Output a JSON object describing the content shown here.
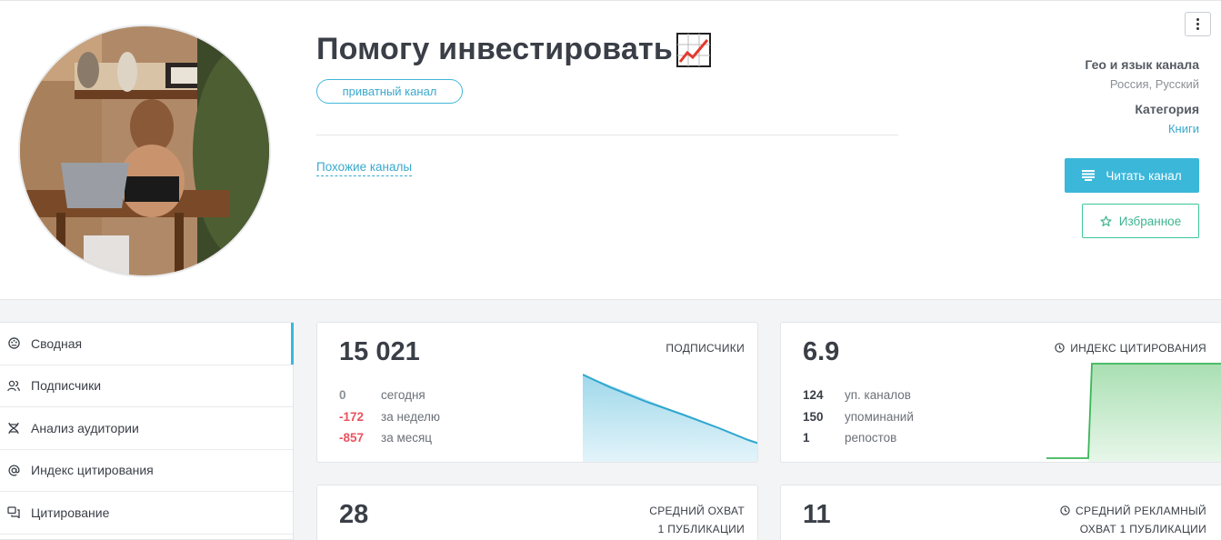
{
  "channel": {
    "title": "Помогу инвестировать",
    "title_icon": "chart-increasing-icon",
    "badge": "приватный канал",
    "similar_link": "Похожие каналы"
  },
  "meta": {
    "geo_label": "Гео и язык канала",
    "geo_value": "Россия, Русский",
    "category_label": "Категория",
    "category_value": "Книги"
  },
  "actions": {
    "read": "Читать канал",
    "favorite": "Избранное"
  },
  "sidebar": {
    "items": [
      {
        "label": "Сводная",
        "icon": "palette-icon",
        "active": true
      },
      {
        "label": "Подписчики",
        "icon": "users-icon",
        "active": false
      },
      {
        "label": "Анализ аудитории",
        "icon": "dna-icon",
        "active": false
      },
      {
        "label": "Индекс цитирования",
        "icon": "at-sign-icon",
        "active": false
      },
      {
        "label": "Цитирование",
        "icon": "quote-icon",
        "active": false
      }
    ]
  },
  "cards": {
    "subscribers": {
      "value": "15 021",
      "label": "ПОДПИСЧИКИ",
      "rows": [
        {
          "num": "0",
          "text": "сегодня"
        },
        {
          "num": "-172",
          "text": "за неделю"
        },
        {
          "num": "-857",
          "text": "за месяц"
        }
      ],
      "trend": [
        1.0,
        0.0
      ],
      "color": "#3aa9cc"
    },
    "citation": {
      "value": "6.9",
      "label": "ИНДЕКС ЦИТИРОВАНИЯ",
      "rows": [
        {
          "num": "124",
          "text": "уп. каналов"
        },
        {
          "num": "150",
          "text": "упоминаний"
        },
        {
          "num": "1",
          "text": "репостов"
        }
      ],
      "color": "#3cb55a"
    },
    "reach": {
      "value": "28",
      "label_line1": "СРЕДНИЙ ОХВАТ",
      "label_line2": "1 ПУБЛИКАЦИИ"
    },
    "ad_reach": {
      "value": "11",
      "label_line1": "СРЕДНИЙ РЕКЛАМНЫЙ",
      "label_line2": "ОХВАТ 1 ПУБЛИКАЦИИ"
    }
  }
}
